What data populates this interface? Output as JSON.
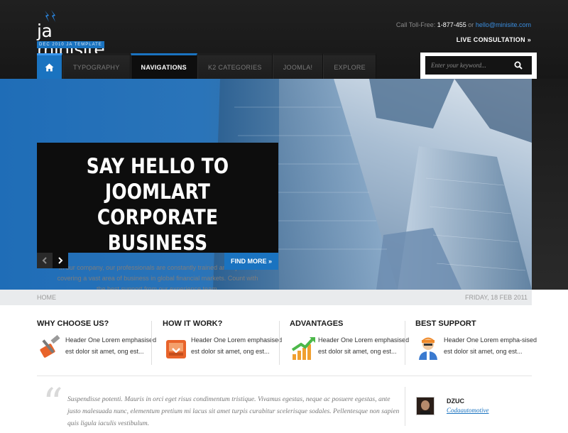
{
  "header": {
    "logo_text": "ja minisite",
    "logo_tagline": "DEC 2010 JA TEMPLATE",
    "toll_label": "Call Toll-Free:",
    "toll_number": "1-877-455",
    "toll_or": "or",
    "email": "hello@minisite.com",
    "live_consultation": "LIVE CONSULTATION »"
  },
  "nav": {
    "home_icon": "home-icon",
    "items": [
      {
        "label": "TYPOGRAPHY",
        "active": false
      },
      {
        "label": "NAVIGATIONS",
        "active": true
      },
      {
        "label": "K2 CATEGORIES",
        "active": false
      },
      {
        "label": "JOOMLA!",
        "active": false
      },
      {
        "label": "EXPLORE",
        "active": false
      }
    ],
    "search_placeholder": "Enter your keyword...",
    "accent": "#1a73c0"
  },
  "hero": {
    "title_line1": "SAY HELLO TO JOOMLART",
    "title_line2": "CORPORATE BUSINESS",
    "body": "In our company, our professionals are constantly trained and updated, covering a vast area of business in global financial markets. Count with the best support from our experience team.",
    "cta": "FIND MORE »"
  },
  "breadcrumb": {
    "home": "HOME",
    "date": "FRIDAY, 18 FEB 2011"
  },
  "features": [
    {
      "title": "WHY CHOOSE US?",
      "text": "Header One Lorem emphasised est dolor sit amet, ong est...",
      "icon": "hammer-tag-icon"
    },
    {
      "title": "HOW IT WORK?",
      "text": "Header One Lorem emphasised est dolor sit amet, ong est...",
      "icon": "inbox-tray-icon"
    },
    {
      "title": "ADVANTAGES",
      "text": "Header One Lorem emphasised est dolor sit amet, ong est...",
      "icon": "growth-chart-icon"
    },
    {
      "title": "BEST SUPPORT",
      "text": "Header One Lorem empha-sised est dolor sit amet, ong est...",
      "icon": "worker-avatar-icon"
    }
  ],
  "testimonial": {
    "quote": "Suspendisse potenti. Mauris in orci eget risus condimentum tristique. Vivamus egestas, neque ac posuere egestas, ante justo malesuada nunc, elementum pretium mi lacus sit amet turpis curabitur scelerisque sodales. Pellentesque non sapien quis ligula iaculis vestibulum.",
    "author": "DZUC",
    "company": "Codaautomotive"
  }
}
